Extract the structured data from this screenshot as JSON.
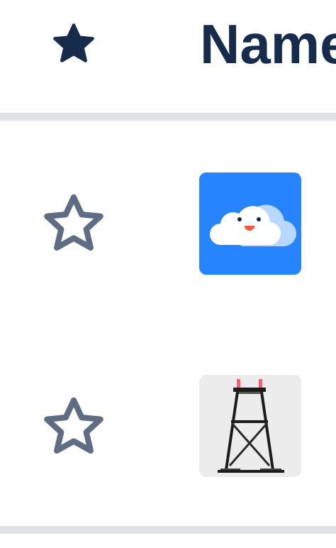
{
  "header": {
    "starred_icon": "star-filled-icon",
    "name_label": "Name"
  },
  "rows": [
    {
      "star_icon": "star-outline-icon",
      "avatar_icon": "cloud-avatar-icon",
      "avatar_color": "#2684ff"
    },
    {
      "star_icon": "star-outline-icon",
      "avatar_icon": "tower-avatar-icon",
      "avatar_color": "#ececec"
    }
  ],
  "colors": {
    "header_text": "#172b4d",
    "star_outline": "#5e6c84",
    "divider": "#dfe1e6"
  }
}
